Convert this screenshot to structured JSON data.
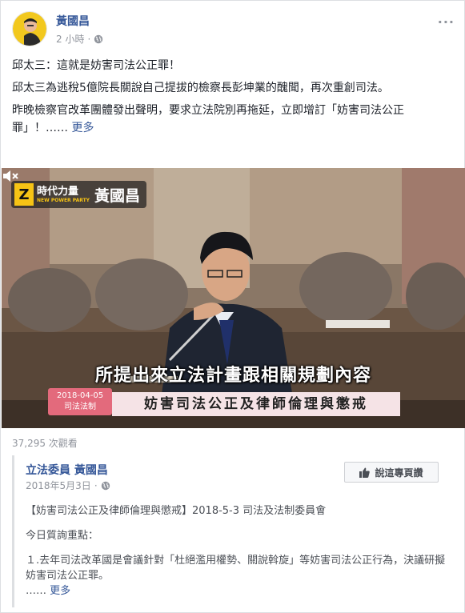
{
  "post": {
    "author": "黃國昌",
    "time": "2 小時",
    "dot": "·",
    "more": "···",
    "paragraph1": "邱太三：這就是妨害司法公正罪！",
    "paragraph2": "邱太三為逃稅5億院長關說自己提拔的檢察長彭坤業的醜聞，再次重創司法。",
    "paragraph3": "昨晚檢察官改革團體發出聲明，要求立法院別再拖延，立即增訂「妨害司法公正罪」！……",
    "see_more": "更多"
  },
  "video": {
    "logo_party_zh": "時代力量",
    "logo_party_en": "NEW POWER PARTY",
    "logo_name": "黃國昌",
    "subtitle": "所提出來立法計畫跟相關規劃內容",
    "tag_date": "2018-04-05",
    "tag_label": "司法法制",
    "topic": "妨害司法公正及律師倫理與懲戒",
    "mute_icon": "speaker-muted-icon"
  },
  "views": "37,295 次觀看",
  "shared": {
    "author": "立法委員 黃國昌",
    "date": "2018年5月3日",
    "dot": "·",
    "like_button": "說這專頁讚",
    "line1": "【妨害司法公正及律師倫理與懲戒】2018-5-3 司法及法制委員會",
    "line2": "今日質詢重點：",
    "line3": "１.去年司法改革國是會議針對「杜絕濫用權勢、關說斡旋」等妨害司法公正行為，決議研擬妨害司法公正罪。",
    "line4_prefix": "……",
    "see_more": "更多"
  }
}
